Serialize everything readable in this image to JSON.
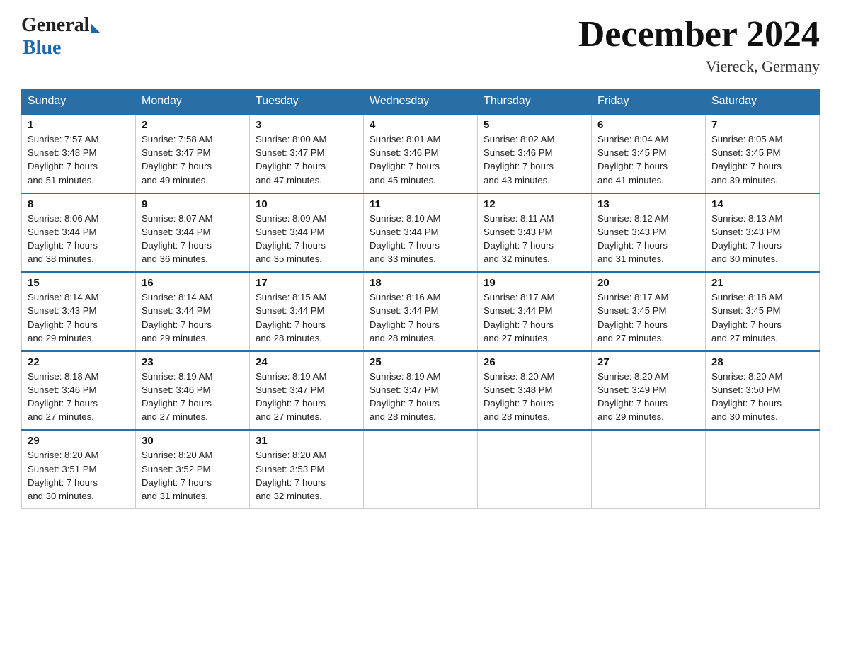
{
  "header": {
    "logo_general": "General",
    "logo_blue": "Blue",
    "title": "December 2024",
    "location": "Viereck, Germany"
  },
  "days_of_week": [
    "Sunday",
    "Monday",
    "Tuesday",
    "Wednesday",
    "Thursday",
    "Friday",
    "Saturday"
  ],
  "weeks": [
    [
      {
        "day": "1",
        "sunrise": "7:57 AM",
        "sunset": "3:48 PM",
        "daylight": "7 hours and 51 minutes."
      },
      {
        "day": "2",
        "sunrise": "7:58 AM",
        "sunset": "3:47 PM",
        "daylight": "7 hours and 49 minutes."
      },
      {
        "day": "3",
        "sunrise": "8:00 AM",
        "sunset": "3:47 PM",
        "daylight": "7 hours and 47 minutes."
      },
      {
        "day": "4",
        "sunrise": "8:01 AM",
        "sunset": "3:46 PM",
        "daylight": "7 hours and 45 minutes."
      },
      {
        "day": "5",
        "sunrise": "8:02 AM",
        "sunset": "3:46 PM",
        "daylight": "7 hours and 43 minutes."
      },
      {
        "day": "6",
        "sunrise": "8:04 AM",
        "sunset": "3:45 PM",
        "daylight": "7 hours and 41 minutes."
      },
      {
        "day": "7",
        "sunrise": "8:05 AM",
        "sunset": "3:45 PM",
        "daylight": "7 hours and 39 minutes."
      }
    ],
    [
      {
        "day": "8",
        "sunrise": "8:06 AM",
        "sunset": "3:44 PM",
        "daylight": "7 hours and 38 minutes."
      },
      {
        "day": "9",
        "sunrise": "8:07 AM",
        "sunset": "3:44 PM",
        "daylight": "7 hours and 36 minutes."
      },
      {
        "day": "10",
        "sunrise": "8:09 AM",
        "sunset": "3:44 PM",
        "daylight": "7 hours and 35 minutes."
      },
      {
        "day": "11",
        "sunrise": "8:10 AM",
        "sunset": "3:44 PM",
        "daylight": "7 hours and 33 minutes."
      },
      {
        "day": "12",
        "sunrise": "8:11 AM",
        "sunset": "3:43 PM",
        "daylight": "7 hours and 32 minutes."
      },
      {
        "day": "13",
        "sunrise": "8:12 AM",
        "sunset": "3:43 PM",
        "daylight": "7 hours and 31 minutes."
      },
      {
        "day": "14",
        "sunrise": "8:13 AM",
        "sunset": "3:43 PM",
        "daylight": "7 hours and 30 minutes."
      }
    ],
    [
      {
        "day": "15",
        "sunrise": "8:14 AM",
        "sunset": "3:43 PM",
        "daylight": "7 hours and 29 minutes."
      },
      {
        "day": "16",
        "sunrise": "8:14 AM",
        "sunset": "3:44 PM",
        "daylight": "7 hours and 29 minutes."
      },
      {
        "day": "17",
        "sunrise": "8:15 AM",
        "sunset": "3:44 PM",
        "daylight": "7 hours and 28 minutes."
      },
      {
        "day": "18",
        "sunrise": "8:16 AM",
        "sunset": "3:44 PM",
        "daylight": "7 hours and 28 minutes."
      },
      {
        "day": "19",
        "sunrise": "8:17 AM",
        "sunset": "3:44 PM",
        "daylight": "7 hours and 27 minutes."
      },
      {
        "day": "20",
        "sunrise": "8:17 AM",
        "sunset": "3:45 PM",
        "daylight": "7 hours and 27 minutes."
      },
      {
        "day": "21",
        "sunrise": "8:18 AM",
        "sunset": "3:45 PM",
        "daylight": "7 hours and 27 minutes."
      }
    ],
    [
      {
        "day": "22",
        "sunrise": "8:18 AM",
        "sunset": "3:46 PM",
        "daylight": "7 hours and 27 minutes."
      },
      {
        "day": "23",
        "sunrise": "8:19 AM",
        "sunset": "3:46 PM",
        "daylight": "7 hours and 27 minutes."
      },
      {
        "day": "24",
        "sunrise": "8:19 AM",
        "sunset": "3:47 PM",
        "daylight": "7 hours and 27 minutes."
      },
      {
        "day": "25",
        "sunrise": "8:19 AM",
        "sunset": "3:47 PM",
        "daylight": "7 hours and 28 minutes."
      },
      {
        "day": "26",
        "sunrise": "8:20 AM",
        "sunset": "3:48 PM",
        "daylight": "7 hours and 28 minutes."
      },
      {
        "day": "27",
        "sunrise": "8:20 AM",
        "sunset": "3:49 PM",
        "daylight": "7 hours and 29 minutes."
      },
      {
        "day": "28",
        "sunrise": "8:20 AM",
        "sunset": "3:50 PM",
        "daylight": "7 hours and 30 minutes."
      }
    ],
    [
      {
        "day": "29",
        "sunrise": "8:20 AM",
        "sunset": "3:51 PM",
        "daylight": "7 hours and 30 minutes."
      },
      {
        "day": "30",
        "sunrise": "8:20 AM",
        "sunset": "3:52 PM",
        "daylight": "7 hours and 31 minutes."
      },
      {
        "day": "31",
        "sunrise": "8:20 AM",
        "sunset": "3:53 PM",
        "daylight": "7 hours and 32 minutes."
      },
      null,
      null,
      null,
      null
    ]
  ],
  "labels": {
    "sunrise_prefix": "Sunrise: ",
    "sunset_prefix": "Sunset: ",
    "daylight_prefix": "Daylight: "
  }
}
